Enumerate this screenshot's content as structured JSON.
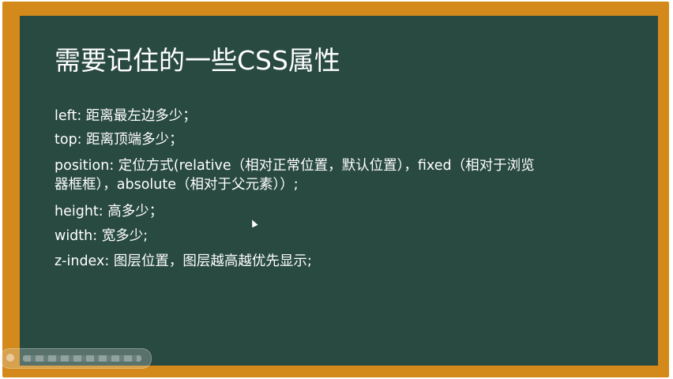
{
  "slide": {
    "title": "需要记住的一些CSS属性",
    "lines": [
      "left: 距离最左边多少；",
      "top: 距离顶端多少；",
      "position: 定位方式(relative（相对正常位置，默认位置），fixed（相对于浏览",
      "器框框），absolute（相对于父元素））;",
      "height: 高多少；",
      "width: 宽多少;",
      "z-index: 图层位置，图层越高越优先显示;"
    ]
  },
  "colors": {
    "board_frame": "#d38a1a",
    "slate": "#294a41",
    "text": "#ffffff"
  }
}
